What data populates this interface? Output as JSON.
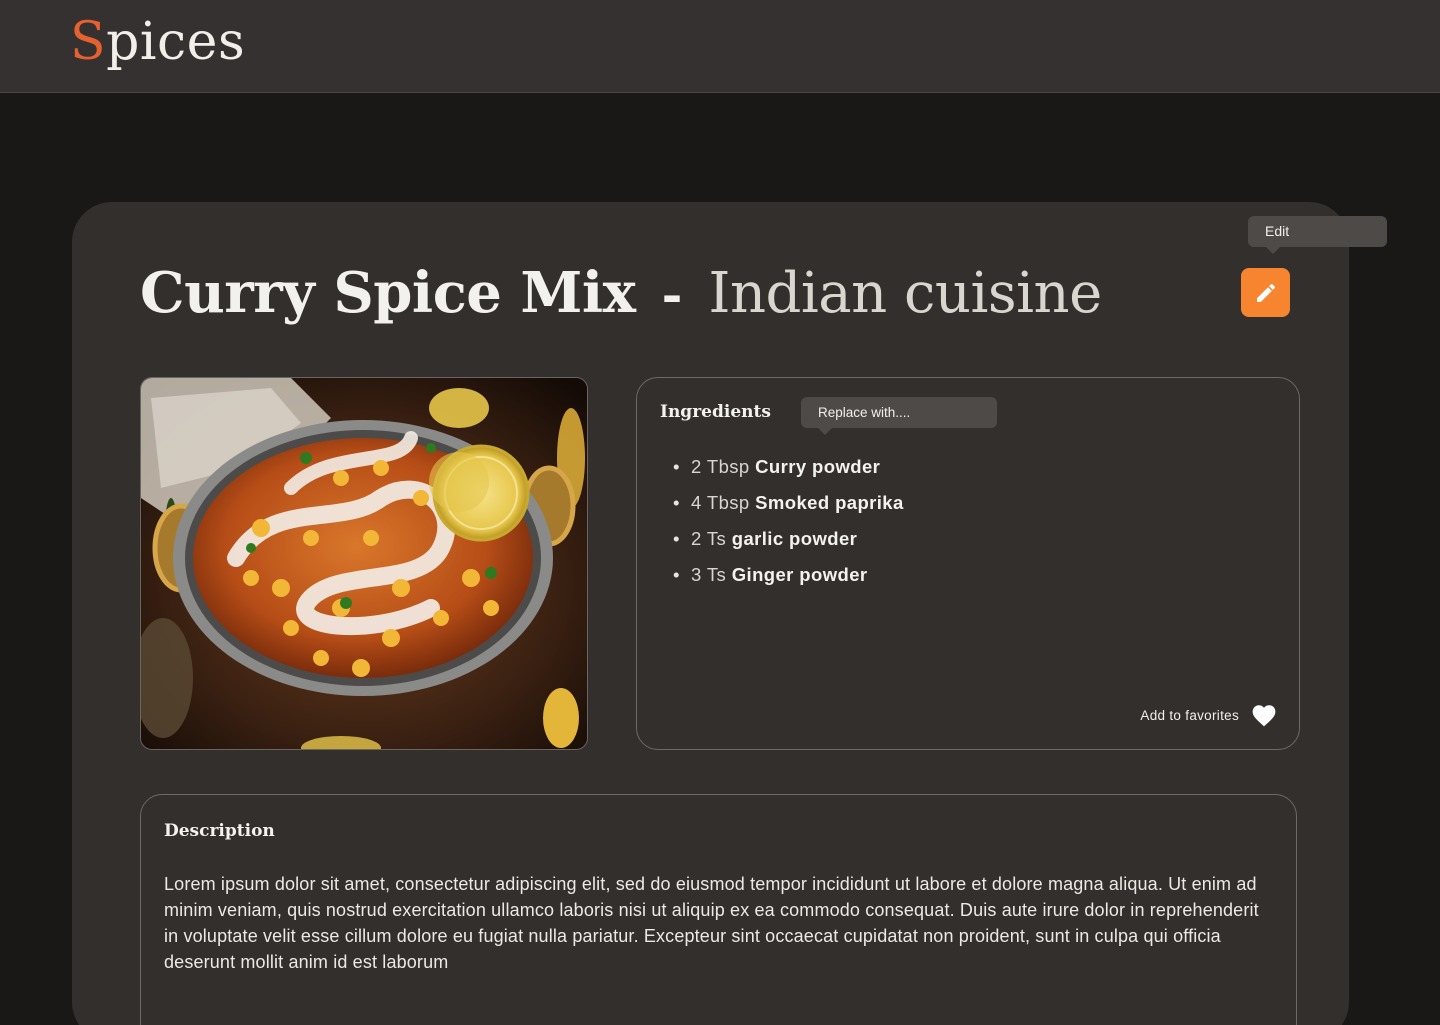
{
  "header": {
    "logo_first_letter": "S",
    "logo_rest": "pices"
  },
  "recipe": {
    "title": "Curry Spice Mix",
    "separator": "-",
    "cuisine": "Indian cuisine",
    "edit_tooltip": "Edit",
    "edit_icon": "pencil-icon",
    "image_alt": "Bowl of corn curry with lemon slices"
  },
  "ingredients": {
    "title": "Ingredients",
    "replace_tooltip": "Replace with....",
    "items": [
      {
        "qty": "2 Tbsp",
        "name": "Curry powder"
      },
      {
        "qty": "4 Tbsp",
        "name": "Smoked paprika"
      },
      {
        "qty": "2 Ts",
        "name": "garlic powder"
      },
      {
        "qty": "3 Ts",
        "name": "Ginger powder"
      }
    ],
    "favorites_label": "Add to favorites",
    "favorites_icon": "heart-icon"
  },
  "description": {
    "title": "Description",
    "text": "Lorem ipsum dolor sit amet, consectetur adipiscing elit, sed do eiusmod tempor incididunt ut labore et dolore magna aliqua. Ut enim ad minim veniam, quis nostrud exercitation ullamco laboris nisi ut aliquip ex ea commodo consequat. Duis aute irure dolor in reprehenderit in voluptate velit esse cillum dolore eu fugiat nulla pariatur. Excepteur sint occaecat cupidatat non proident, sunt in culpa qui officia deserunt mollit anim id est laborum"
  },
  "colors": {
    "accent": "#f7852f",
    "logo_accent": "#e5612f",
    "background": "#1a1817",
    "card": "#332f2d",
    "topbar": "#353130"
  }
}
